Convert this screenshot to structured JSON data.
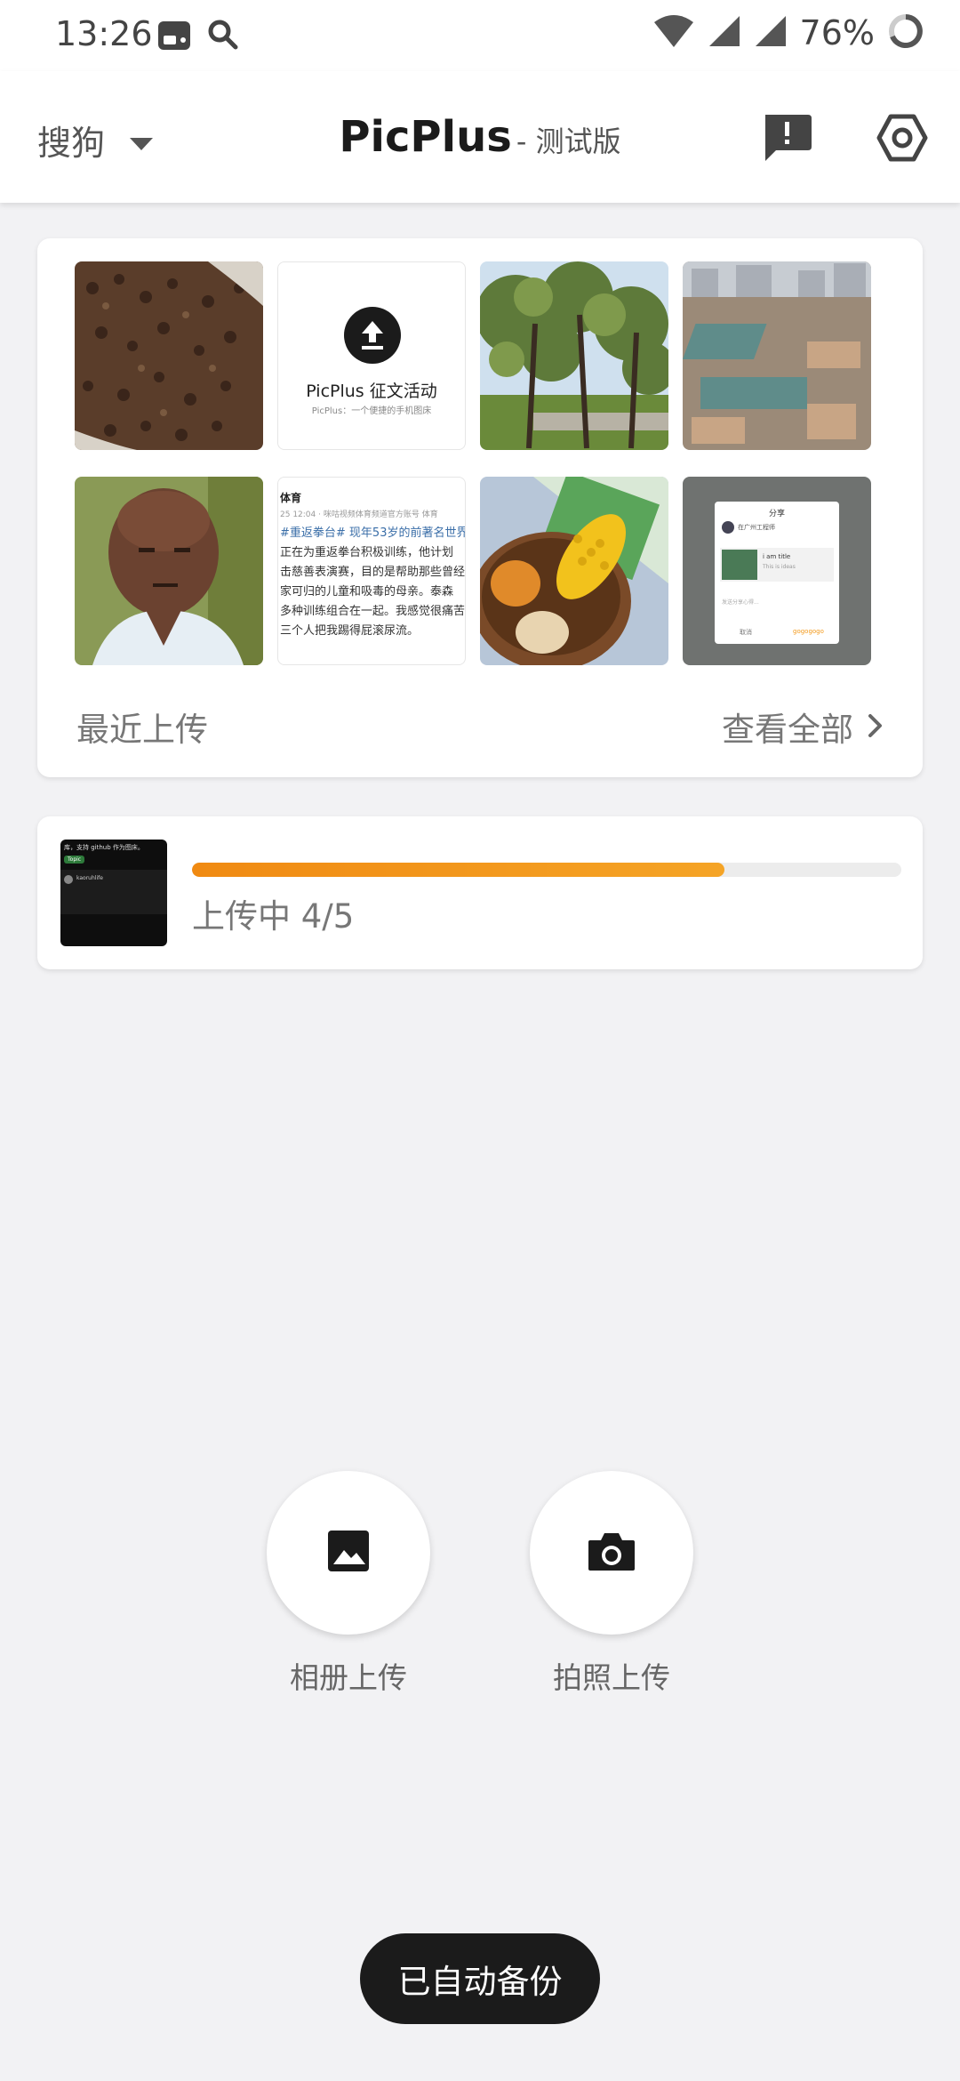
{
  "status_bar": {
    "time": "13:26",
    "battery": "76%",
    "icons": [
      "notification-app-icon",
      "search-icon",
      "wifi-icon",
      "signal-icon",
      "signal-icon",
      "battery-ring-icon"
    ]
  },
  "header": {
    "source_selector": "搜狗",
    "title": "PicPlus",
    "subtitle": "- 测试版",
    "actions": [
      "feedback-icon",
      "settings-icon"
    ]
  },
  "recent": {
    "footer_label": "最近上传",
    "view_all": "查看全部",
    "promo_tile": {
      "title": "PicPlus 征文活动",
      "subtitle": "PicPlus：一个便捷的手机图床"
    },
    "article_tile": {
      "header": "体育",
      "meta": "25 12:04 · 咪咕视频体育频道官方账号 体育",
      "lines": [
        "#重返拳台# 现年53岁的前著名世界",
        "正在为重返拳台积极训练，他计划",
        "击慈善表演赛，目的是帮助那些曾经",
        "家可归的儿童和吸毒的母亲。泰森",
        "多种训练组合在一起。我感觉很痛苦",
        "三个人把我踢得屁滚尿流。"
      ]
    },
    "share_tile": {
      "title": "分享",
      "account": "在广州工程师",
      "card_title": "i am title",
      "card_desc": "This is ideas",
      "input_placeholder": "发送分享心得...",
      "cancel": "取消",
      "confirm": "gogogogo"
    }
  },
  "upload": {
    "status": "上传中 4/5",
    "progress": 0.75,
    "thumb_text": "库，支持 github 作为图床。",
    "thumb_tag": "Topic",
    "thumb_user": "kaoruhlife"
  },
  "actions": {
    "album_label": "相册上传",
    "camera_label": "拍照上传"
  },
  "backup_badge": "已自动备份",
  "colors": {
    "accent": "#f39a1c",
    "track": "#ececec",
    "dark": "#1b1b1b"
  }
}
